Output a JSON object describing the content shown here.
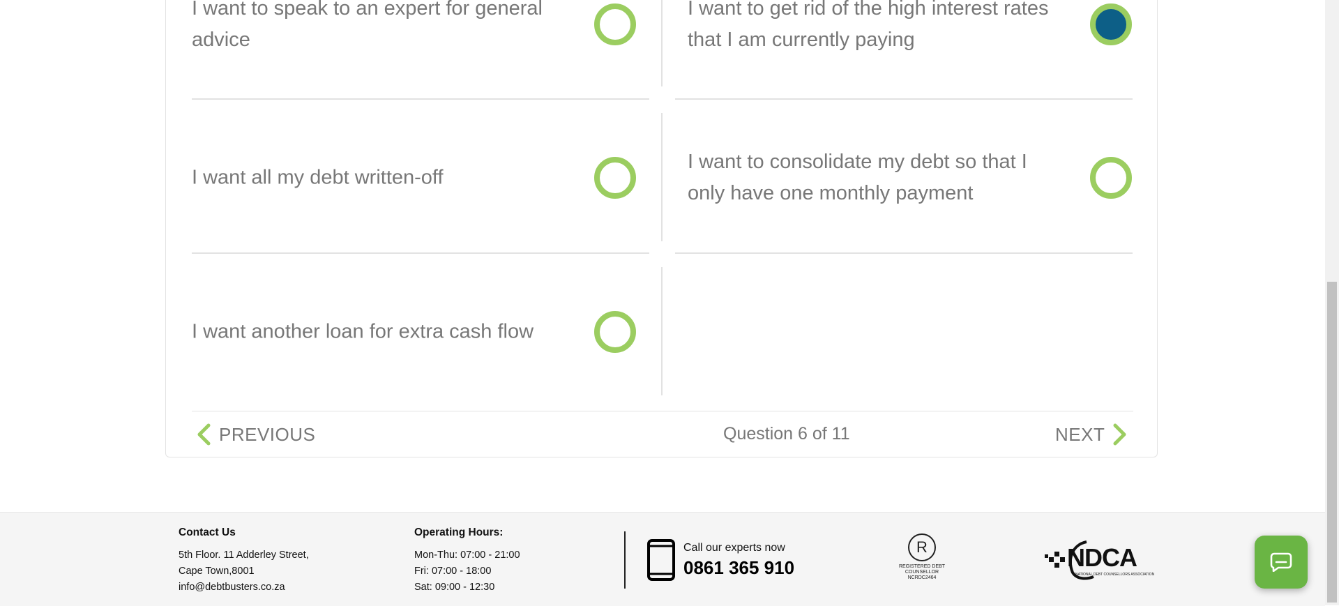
{
  "quiz": {
    "options": [
      {
        "label": "I want to speak to an expert for general advice",
        "selected": false
      },
      {
        "label": "I want to get rid of the high interest rates that I am currently paying",
        "selected": true
      },
      {
        "label": "I want all my debt written-off",
        "selected": false
      },
      {
        "label": "I want to consolidate my debt so that I only have one monthly payment",
        "selected": false
      },
      {
        "label": "I want another loan for extra cash flow",
        "selected": false
      }
    ],
    "nav": {
      "previous_label": "PREVIOUS",
      "next_label": "NEXT",
      "progress_text": "Question 6 of 11"
    }
  },
  "footer": {
    "contact": {
      "heading": "Contact Us",
      "address_line1": "5th Floor. 11 Adderley Street,",
      "address_line2": "Cape Town,8001",
      "email": "info@debtbusters.co.za"
    },
    "hours": {
      "heading": "Operating Hours:",
      "line1": "Mon-Thu: 07:00 - 21:00",
      "line2": "Fri: 07:00 - 18:00",
      "line3": "Sat: 09:00 - 12:30"
    },
    "call": {
      "label": "Call our experts now",
      "number": "0861 365 910"
    },
    "badges": {
      "registered_symbol": "R",
      "registered_text": "REGISTERED DEBT COUNSELLOR NCRDC2464",
      "ndca_text": "NDCA",
      "ndca_sub": "NATIONAL DEBT COUNSELLORS ASSOCIATION"
    }
  },
  "colors": {
    "accent_green": "#9bcd60",
    "selected_blue": "#0d5f87",
    "chat_green": "#6ab544",
    "text_gray": "#777777"
  },
  "icons": {
    "previous": "chevron-left-icon",
    "next": "chevron-right-icon",
    "phone": "phone-icon",
    "chat": "chat-icon"
  }
}
